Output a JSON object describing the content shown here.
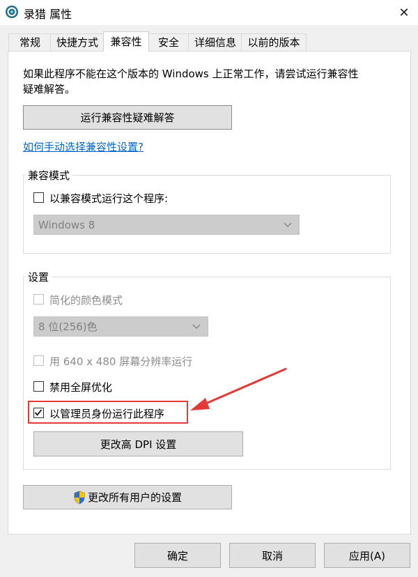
{
  "window": {
    "title": "录猎 属性",
    "close_glyph": "✕"
  },
  "tabs": [
    {
      "label": "常规"
    },
    {
      "label": "快捷方式"
    },
    {
      "label": "兼容性"
    },
    {
      "label": "安全"
    },
    {
      "label": "详细信息"
    },
    {
      "label": "以前的版本"
    }
  ],
  "compat": {
    "intro_line1": "如果此程序不能在这个版本的 Windows 上正常工作，请尝试运行兼容性",
    "intro_line2": "疑难解答。",
    "troubleshoot_button": "运行兼容性疑难解答",
    "manual_link": "如何手动选择兼容性设置?"
  },
  "compat_mode": {
    "group_title": "兼容模式",
    "checkbox_label": "以兼容模式运行这个程序:",
    "checked": false,
    "select_value": "Windows 8"
  },
  "settings": {
    "group_title": "设置",
    "reduced_color_label": "简化的颜色模式",
    "color_select_value": "8 位(256)色",
    "resolution_label": "用 640 x 480 屏幕分辨率运行",
    "fullscreen_label": "禁用全屏优化",
    "admin_label": "以管理员身份运行此程序",
    "admin_checked": true,
    "dpi_button": "更改高 DPI 设置"
  },
  "all_users_button": "更改所有用户的设置",
  "footer": {
    "ok": "确定",
    "cancel": "取消",
    "apply": "应用(A)"
  },
  "colors": {
    "highlight": "#e53935",
    "link": "#0066cc"
  }
}
